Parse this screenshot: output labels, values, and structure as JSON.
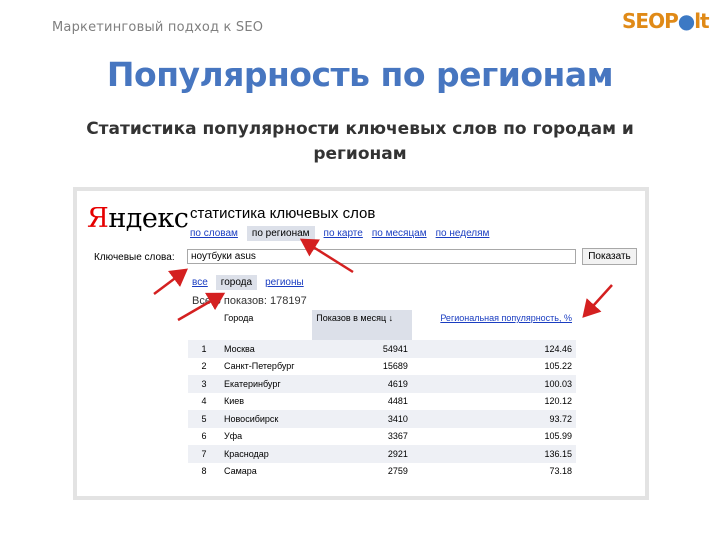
{
  "slide": {
    "header": "Маркетинговый подход к SEO",
    "logo": {
      "part1": "SEOP",
      "dot": "●",
      "part2": "lt"
    },
    "title": "Популярность по регионам",
    "subtitle": "Статистика популярности ключевых слов по городам и регионам"
  },
  "screenshot": {
    "brand": {
      "first_letter": "Я",
      "rest": "ндекс"
    },
    "service_title": "статистика ключевых слов",
    "tabs": [
      {
        "label": "по словам",
        "active": false
      },
      {
        "label": "по регионам",
        "active": true
      },
      {
        "label": "по карте",
        "active": false
      },
      {
        "label": "по месяцам",
        "active": false
      },
      {
        "label": "по неделям",
        "active": false
      }
    ],
    "keywords_label": "Ключевые слова:",
    "keywords_value": "ноутбуки asus",
    "show_button": "Показать",
    "subtabs": [
      {
        "label": "все",
        "active": false
      },
      {
        "label": "города",
        "active": true
      },
      {
        "label": "регионы",
        "active": false
      }
    ],
    "total": "Всего показов: 178197",
    "table": {
      "headers": {
        "city": "Города",
        "shows": "Показов в месяц ↓",
        "regional": "Региональная популярность, %"
      },
      "rows": [
        {
          "rank": "1",
          "city": "Москва",
          "shows": "54941",
          "pop": "124.46"
        },
        {
          "rank": "2",
          "city": "Санкт-Петербург",
          "shows": "15689",
          "pop": "105.22"
        },
        {
          "rank": "3",
          "city": "Екатеринбург",
          "shows": "4619",
          "pop": "100.03"
        },
        {
          "rank": "4",
          "city": "Киев",
          "shows": "4481",
          "pop": "120.12"
        },
        {
          "rank": "5",
          "city": "Новосибирск",
          "shows": "3410",
          "pop": "93.72"
        },
        {
          "rank": "6",
          "city": "Уфа",
          "shows": "3367",
          "pop": "105.99"
        },
        {
          "rank": "7",
          "city": "Краснодар",
          "shows": "2921",
          "pop": "136.15"
        },
        {
          "rank": "8",
          "city": "Самара",
          "shows": "2759",
          "pop": "73.18"
        }
      ]
    }
  },
  "colors": {
    "title": "#4776c0",
    "arrow": "#d42020",
    "brand_red": "#e60000",
    "link": "#1a3dc1",
    "logo_orange": "#e08a17"
  }
}
